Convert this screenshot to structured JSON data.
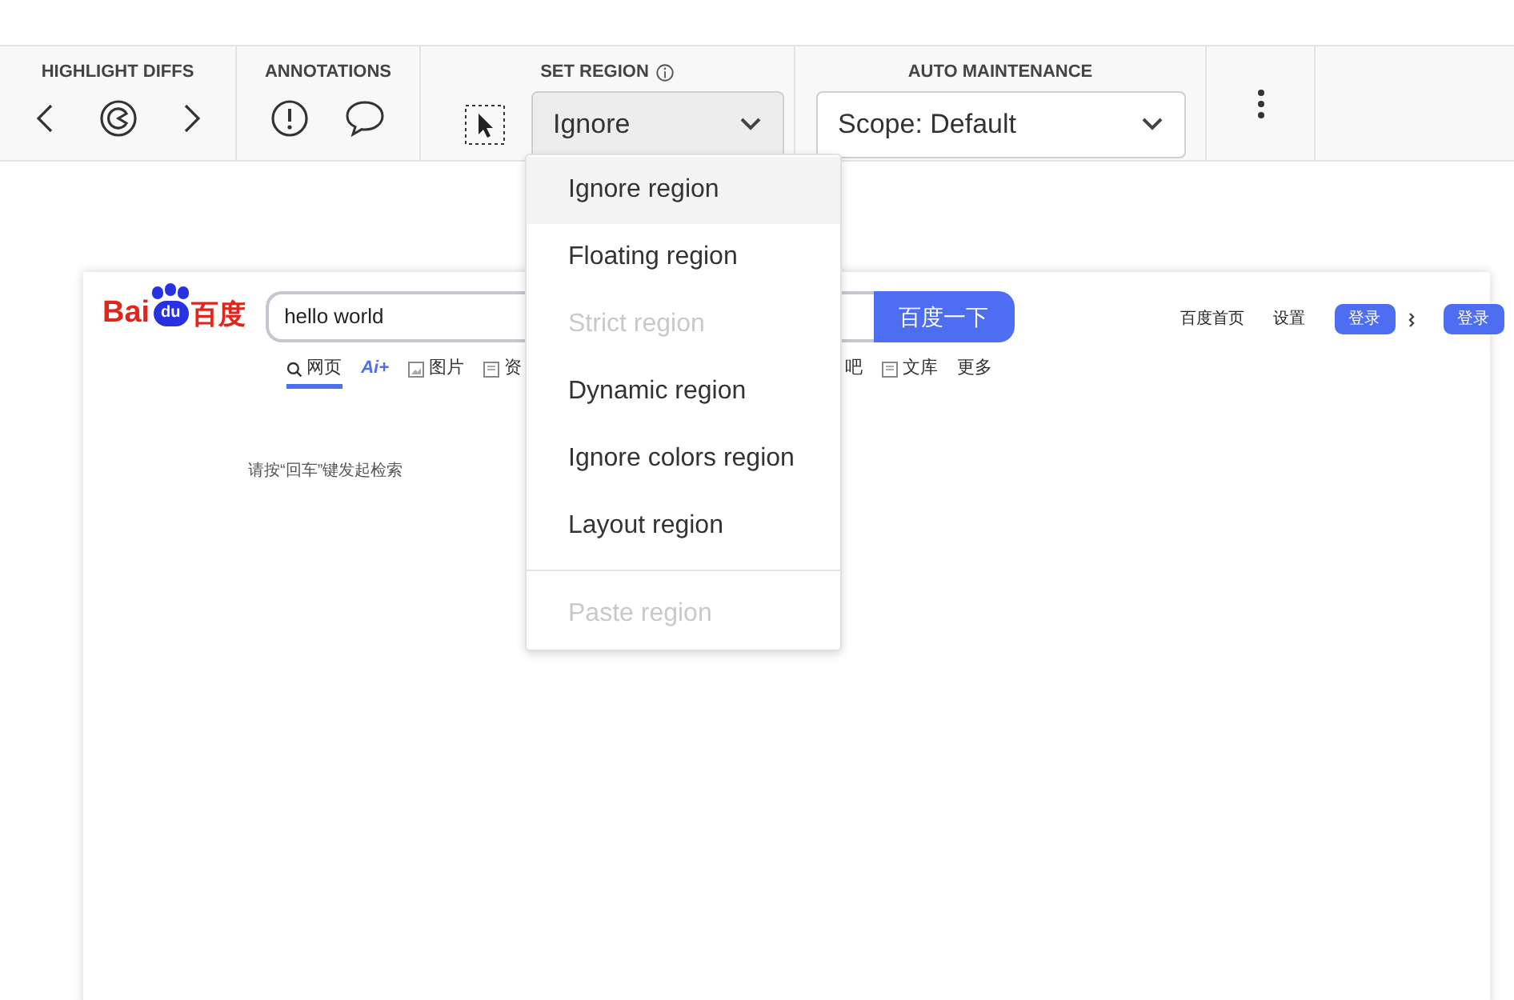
{
  "highlight_diffs": {
    "title": "HIGHLIGHT DIFFS"
  },
  "annotations": {
    "title": "ANNOTATIONS"
  },
  "set_region": {
    "title": "SET REGION",
    "select": {
      "value": "Ignore",
      "expanded": true
    }
  },
  "auto_maintenance": {
    "title": "AUTO MAINTENANCE",
    "select": {
      "value": "Scope: Default",
      "expanded": false
    }
  },
  "region_menu": {
    "groups": [
      [
        {
          "label": "Ignore region",
          "highlighted": true,
          "disabled": false
        },
        {
          "label": "Floating region",
          "highlighted": false,
          "disabled": false
        },
        {
          "label": "Strict region",
          "highlighted": false,
          "disabled": true
        },
        {
          "label": "Dynamic region",
          "highlighted": false,
          "disabled": false
        },
        {
          "label": "Ignore colors region",
          "highlighted": false,
          "disabled": false
        },
        {
          "label": "Layout region",
          "highlighted": false,
          "disabled": false
        }
      ],
      [
        {
          "label": "Paste region",
          "highlighted": false,
          "disabled": true
        }
      ]
    ]
  },
  "screenshot": {
    "logo": {
      "left": "Bai",
      "paw": "du",
      "right": "百度"
    },
    "search": {
      "value": "hello world",
      "button": "百度一下"
    },
    "nav": [
      {
        "label": "网页",
        "selected": true,
        "kind": "search_tab"
      },
      {
        "label": "Ai+",
        "selected": false,
        "kind": "ai"
      },
      {
        "label": "图片",
        "selected": false,
        "kind": "image_tab"
      },
      {
        "label": "资",
        "selected": false,
        "kind": "doc_tab"
      },
      {
        "label": "吧",
        "selected": false,
        "kind": "after_gap"
      },
      {
        "label": "文库",
        "selected": false,
        "kind": "doc_tab"
      },
      {
        "label": "更多",
        "selected": false,
        "kind": "plain"
      }
    ],
    "links": [
      {
        "label": "百度首页",
        "kind": "link"
      },
      {
        "label": "设置",
        "kind": "link"
      },
      {
        "label": "登录",
        "kind": "button"
      },
      {
        "kind": "more_icon"
      },
      {
        "label": "登录",
        "kind": "button"
      }
    ],
    "hint": "请按“回车”键发起检索"
  }
}
